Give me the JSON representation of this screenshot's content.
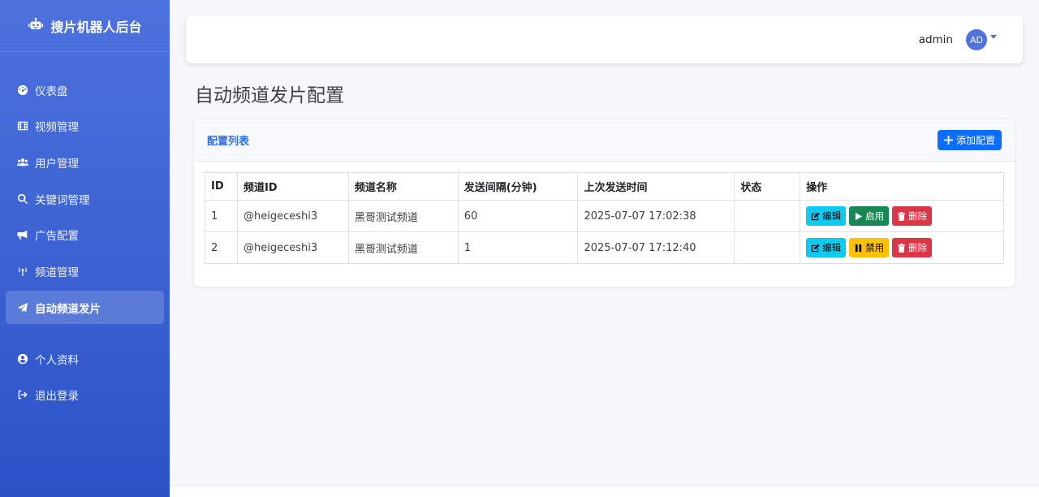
{
  "brand": {
    "title": "搜片机器人后台"
  },
  "sidebar": {
    "items": [
      {
        "label": "仪表盘",
        "icon": "dashboard-icon"
      },
      {
        "label": "视频管理",
        "icon": "film-icon"
      },
      {
        "label": "用户管理",
        "icon": "users-icon"
      },
      {
        "label": "关键词管理",
        "icon": "search-icon"
      },
      {
        "label": "广告配置",
        "icon": "megaphone-icon"
      },
      {
        "label": "频道管理",
        "icon": "broadcast-icon"
      },
      {
        "label": "自动频道发片",
        "icon": "paper-plane-icon",
        "active": true
      }
    ],
    "secondary": [
      {
        "label": "个人资料",
        "icon": "user-circle-icon"
      },
      {
        "label": "退出登录",
        "icon": "sign-out-icon"
      }
    ]
  },
  "topbar": {
    "username": "admin",
    "avatar": "AD"
  },
  "page": {
    "title": "自动频道发片配置"
  },
  "card": {
    "title": "配置列表",
    "add_label": "添加配置"
  },
  "table": {
    "headers": [
      "ID",
      "频道ID",
      "频道名称",
      "发送间隔(分钟)",
      "上次发送时间",
      "状态",
      "操作"
    ],
    "rows": [
      {
        "id": "1",
        "channel_id": "@heigeceshi3",
        "channel_name": "黑哥测试频道",
        "interval": "60",
        "last_sent": "2025-07-07 17:02:38",
        "status": "",
        "toggle_label": "启用",
        "toggle_type": "enable"
      },
      {
        "id": "2",
        "channel_id": "@heigeceshi3",
        "channel_name": "黑哥测试频道",
        "interval": "1",
        "last_sent": "2025-07-07 17:12:40",
        "status": "",
        "toggle_label": "禁用",
        "toggle_type": "disable"
      }
    ],
    "edit_label": "编辑",
    "delete_label": "删除"
  },
  "colors": {
    "sidebar_top": "#4d72de",
    "sidebar_bottom": "#2b52c8",
    "primary": "#0d6efd",
    "info": "#0dcaf0",
    "success": "#198754",
    "warning": "#ffc107",
    "danger": "#dc3545"
  }
}
